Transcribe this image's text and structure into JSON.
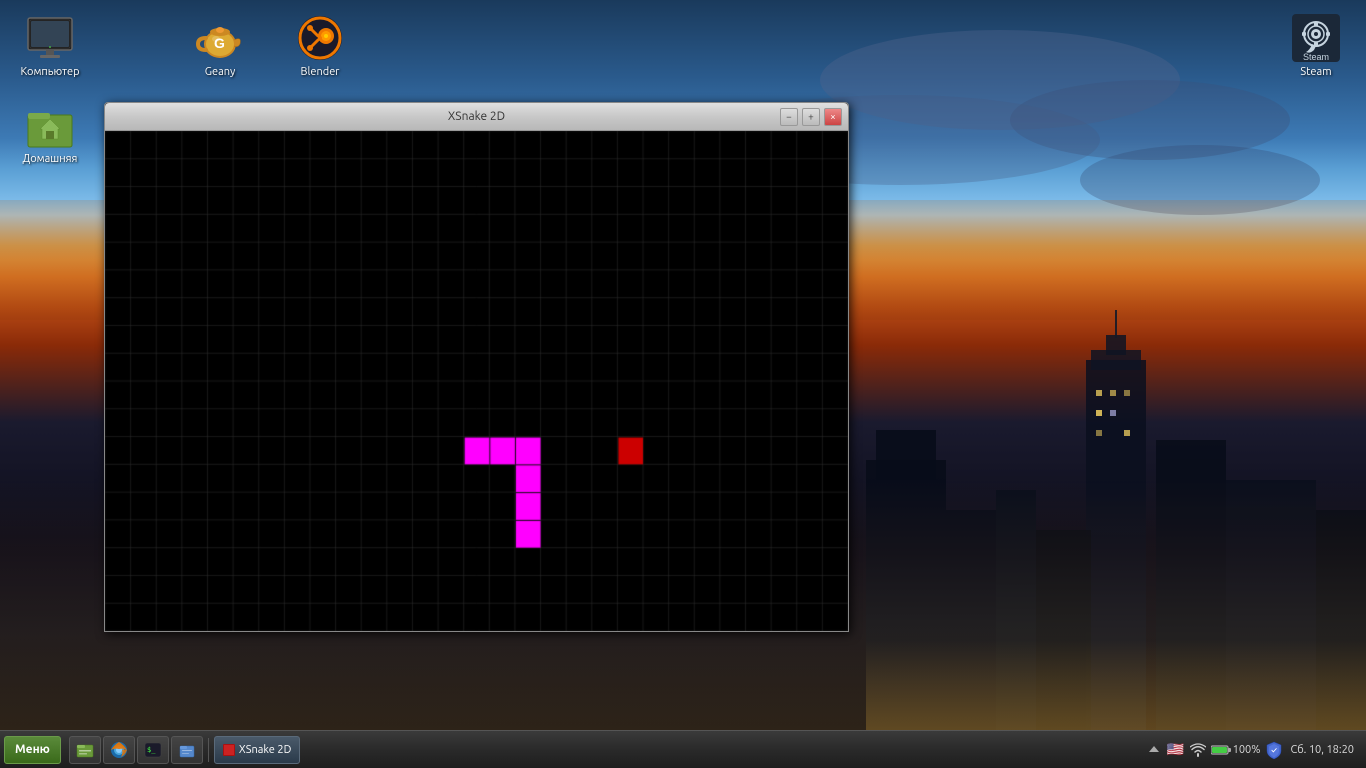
{
  "desktop": {
    "icons_left": [
      {
        "id": "computer",
        "label": "Компьютер",
        "icon": "monitor"
      },
      {
        "id": "home",
        "label": "Домашняя",
        "icon": "home"
      }
    ],
    "icons_topright": [
      {
        "id": "steam",
        "label": "Steam",
        "icon": "steam"
      }
    ]
  },
  "desktop_apps_row2": [
    {
      "id": "geany",
      "label": "Geany",
      "icon": "geany"
    },
    {
      "id": "blender",
      "label": "Blender",
      "icon": "blender"
    }
  ],
  "window": {
    "title": "XSnake 2D",
    "controls": {
      "minimize": "−",
      "maximize": "+",
      "close": "×"
    },
    "game": {
      "grid_cols": 29,
      "grid_rows": 18,
      "cell_size": 25,
      "snake_color": "#ff00ff",
      "food_color": "#cc0000",
      "grid_color": "#333333",
      "bg_color": "#000000",
      "snake_segments": [
        {
          "col": 14,
          "row": 11
        },
        {
          "col": 15,
          "row": 11
        },
        {
          "col": 16,
          "row": 11
        },
        {
          "col": 16,
          "row": 12
        },
        {
          "col": 16,
          "row": 13
        },
        {
          "col": 16,
          "row": 14
        }
      ],
      "food": {
        "col": 20,
        "row": 11
      }
    }
  },
  "taskbar": {
    "menu_label": "Меню",
    "quick_icons": [
      "file-manager",
      "firefox",
      "terminal",
      "thunar"
    ],
    "active_app": "XSnake 2D",
    "active_app_color": "#cc2222",
    "tray": {
      "arrow_up": "▲",
      "flag_us": "🇺🇸",
      "wifi": "wifi",
      "battery": "100%",
      "shield": "shield",
      "datetime": "Сб. 10, 18:20"
    }
  }
}
